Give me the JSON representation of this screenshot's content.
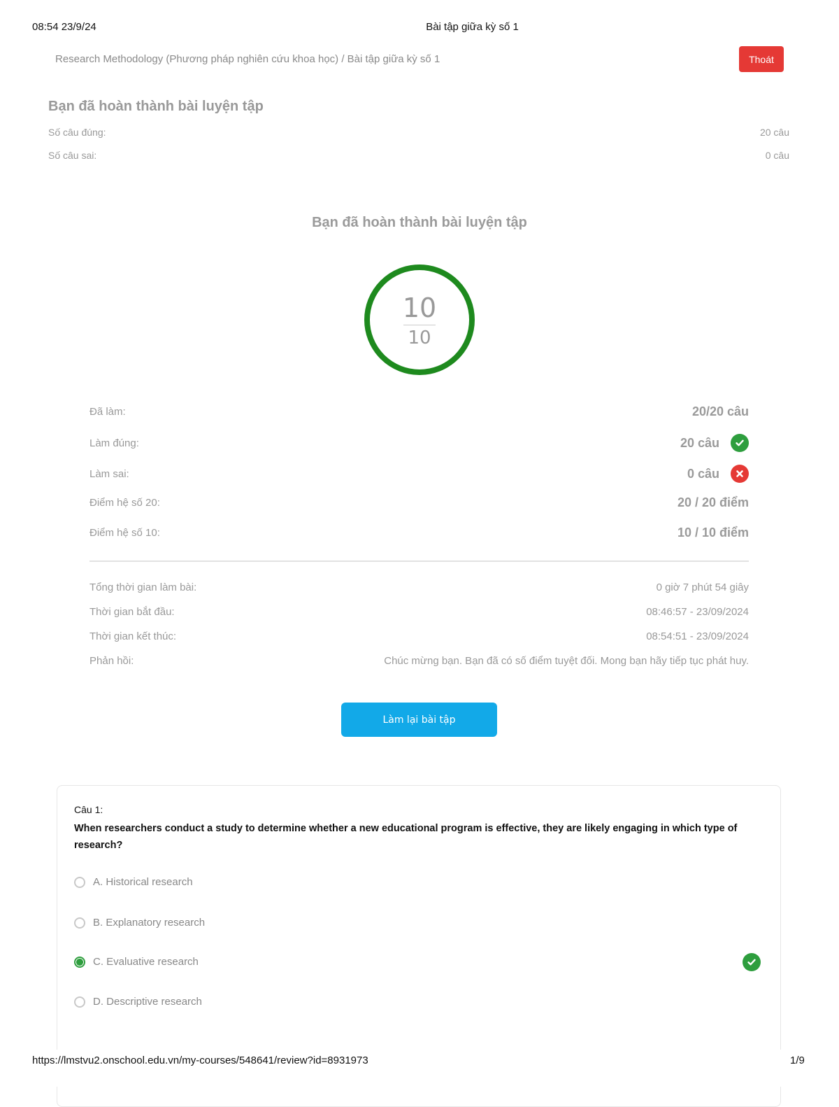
{
  "print_header": {
    "datetime": "08:54 23/9/24",
    "title": "Bài tập giữa kỳ số 1"
  },
  "print_footer": {
    "url": "https://lmstvu2.onschool.edu.vn/my-courses/548641/review?id=8931973",
    "page": "1/9"
  },
  "breadcrumb": "Research Methodology (Phương pháp nghiên cứu khoa học) / Bài tập giữa kỳ số 1",
  "exit_button": "Thoát",
  "summary": {
    "title": "Bạn đã hoàn thành bài luyện tập",
    "correct_label": "Số câu đúng:",
    "correct_value": "20 câu",
    "wrong_label": "Số câu sai:",
    "wrong_value": "0 câu"
  },
  "result": {
    "title": "Bạn đã hoàn thành bài luyện tập",
    "score": "10",
    "max": "10",
    "colors": {
      "ring": "#1e8a1e",
      "correct": "#2e9e3e",
      "wrong": "#e53935",
      "primary": "#12a9e8"
    }
  },
  "stats": [
    {
      "label": "Đã làm:",
      "value": "20/20 câu"
    },
    {
      "label": "Làm đúng:",
      "value": "20 câu",
      "icon": "check-circle-icon"
    },
    {
      "label": "Làm sai:",
      "value": "0 câu",
      "icon": "x-circle-icon"
    },
    {
      "label": "Điểm hệ số 20:",
      "value": "20 / 20 điểm"
    },
    {
      "label": "Điểm hệ số 10:",
      "value": "10 / 10 điểm"
    }
  ],
  "info": [
    {
      "label": "Tổng thời gian làm bài:",
      "value": "0 giờ 7 phút 54 giây"
    },
    {
      "label": "Thời gian bắt đầu:",
      "value": "08:46:57 - 23/09/2024"
    },
    {
      "label": "Thời gian kết thúc:",
      "value": "08:54:51 - 23/09/2024"
    },
    {
      "label": "Phản hồi:",
      "value": "Chúc mừng bạn. Bạn đã có số điểm tuyệt đối. Mong bạn hãy tiếp tục phát huy."
    }
  ],
  "retry_button": "Làm lại bài tập",
  "question": {
    "number": "Câu 1:",
    "text": "When researchers conduct a study to determine whether a new educational program is effective, they are likely engaging in which type of research?",
    "options": [
      {
        "label": "A. Historical research",
        "selected": false
      },
      {
        "label": "B. Explanatory research",
        "selected": false
      },
      {
        "label": "C. Evaluative research",
        "selected": true,
        "correct": true
      },
      {
        "label": "D. Descriptive research",
        "selected": false
      }
    ]
  }
}
